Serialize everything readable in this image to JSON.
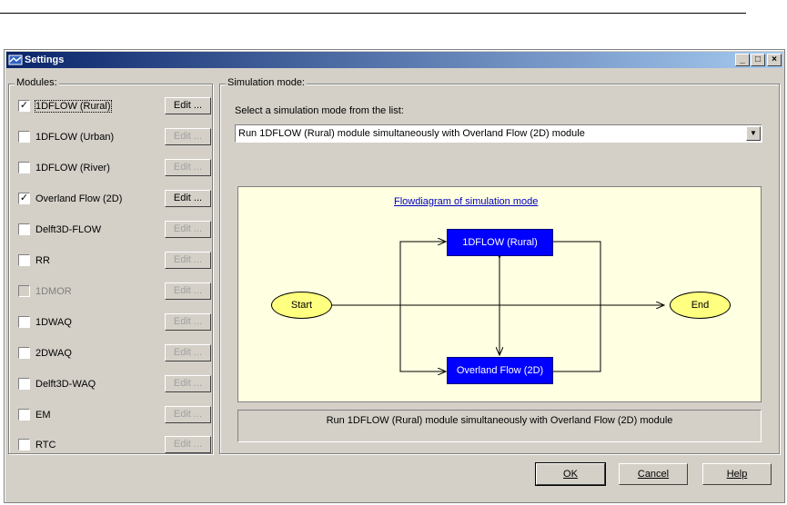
{
  "window": {
    "title": "Settings",
    "minimize": "_",
    "maximize": "□",
    "close": "×"
  },
  "modules": {
    "group_label": "Modules:",
    "items": [
      {
        "label": "1DFLOW (Rural)",
        "checked": true,
        "enabled": true,
        "edit_enabled": true
      },
      {
        "label": "1DFLOW (Urban)",
        "checked": false,
        "enabled": true,
        "edit_enabled": false
      },
      {
        "label": "1DFLOW (River)",
        "checked": false,
        "enabled": true,
        "edit_enabled": false
      },
      {
        "label": "Overland Flow (2D)",
        "checked": true,
        "enabled": true,
        "edit_enabled": true
      },
      {
        "label": "Delft3D-FLOW",
        "checked": false,
        "enabled": true,
        "edit_enabled": false
      },
      {
        "label": "RR",
        "checked": false,
        "enabled": true,
        "edit_enabled": false
      },
      {
        "label": "1DMOR",
        "checked": false,
        "enabled": false,
        "edit_enabled": false
      },
      {
        "label": "1DWAQ",
        "checked": false,
        "enabled": true,
        "edit_enabled": false
      },
      {
        "label": "2DWAQ",
        "checked": false,
        "enabled": true,
        "edit_enabled": false
      },
      {
        "label": "Delft3D-WAQ",
        "checked": false,
        "enabled": true,
        "edit_enabled": false
      },
      {
        "label": "EM",
        "checked": false,
        "enabled": true,
        "edit_enabled": false
      },
      {
        "label": "RTC",
        "checked": false,
        "enabled": true,
        "edit_enabled": false
      }
    ],
    "edit_label": "Edit ..."
  },
  "simulation": {
    "group_label": "Simulation mode:",
    "prompt": "Select a simulation mode from the list:",
    "selected": "Run 1DFLOW (Rural) module simultaneously with Overland Flow (2D) module",
    "diagram_title": "Flowdiagram of simulation mode",
    "diagram": {
      "start": "Start",
      "end": "End",
      "node_top": "1DFLOW (Rural)",
      "node_bottom": "Overland Flow (2D)"
    },
    "description": "Run 1DFLOW (Rural) module simultaneously with Overland Flow (2D) module"
  },
  "buttons": {
    "ok": "OK",
    "cancel": "Cancel",
    "help": "Help"
  },
  "colors": {
    "dialog_bg": "#d4d0c8",
    "diagram_bg": "#ffffe1",
    "node_fill": "#0000ff",
    "ellipse_fill": "#ffff80"
  }
}
